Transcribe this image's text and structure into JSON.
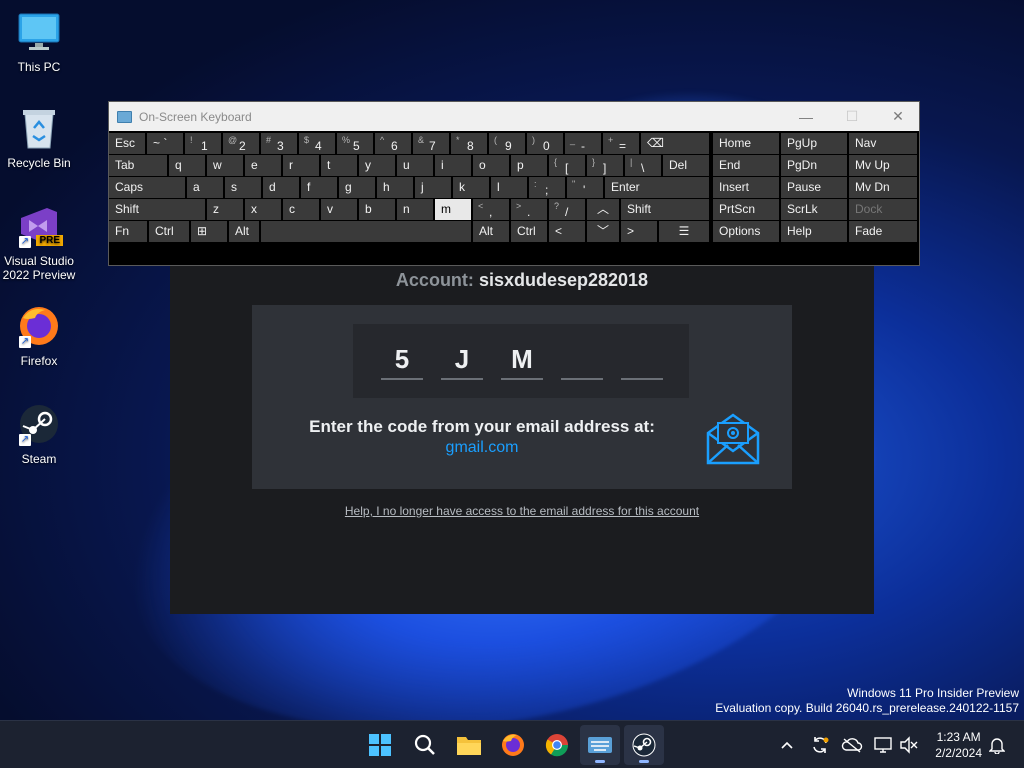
{
  "desktop": {
    "icons": [
      {
        "label": "This PC",
        "icon": "monitor-icon"
      },
      {
        "label": "Recycle Bin",
        "icon": "recycle-bin-icon"
      },
      {
        "label": "Visual Studio\n2022 Preview",
        "icon": "visual-studio-icon",
        "badge": "PRE"
      },
      {
        "label": "Firefox",
        "icon": "firefox-icon"
      },
      {
        "label": "Steam",
        "icon": "steam-icon"
      }
    ]
  },
  "steam": {
    "account_label": "Account:",
    "account_name": "sisxdudesep282018",
    "code_chars": [
      "5",
      "J",
      "M",
      "",
      ""
    ],
    "enter_text": "Enter the code from your email address at:",
    "email_domain": "gmail.com",
    "help_link": "Help, I no longer have access to the email address for this account",
    "accent_color": "#1a9fff"
  },
  "osk": {
    "title": "On-Screen Keyboard",
    "row1": [
      "Esc",
      "1",
      "2",
      "3",
      "4",
      "5",
      "6",
      "7",
      "8",
      "9",
      "0",
      "-",
      "="
    ],
    "row1_shift": [
      "",
      "~ `",
      "!",
      "@",
      "#",
      "$",
      "%",
      "^",
      "&",
      "*",
      "(",
      ")",
      "_",
      "+"
    ],
    "row2": [
      "Tab",
      "q",
      "w",
      "e",
      "r",
      "t",
      "y",
      "u",
      "i",
      "o",
      "p",
      "[",
      "]",
      "\\",
      "Del"
    ],
    "row2_shift": [
      "{",
      "}",
      "|"
    ],
    "row3": [
      "Caps",
      "a",
      "s",
      "d",
      "f",
      "g",
      "h",
      "j",
      "k",
      "l",
      ";",
      "'",
      "Enter"
    ],
    "row3_shift": [
      ":",
      "\""
    ],
    "row4": [
      "Shift",
      "z",
      "x",
      "c",
      "v",
      "b",
      "n",
      "m",
      ",",
      ".",
      "/",
      "Shift"
    ],
    "row4_shift": [
      "<",
      ">",
      "?"
    ],
    "row5": [
      "Fn",
      "Ctrl",
      "Alt",
      "Alt",
      "Ctrl"
    ],
    "nav": [
      [
        "Home",
        "PgUp",
        "Nav"
      ],
      [
        "End",
        "PgDn",
        "Mv Up"
      ],
      [
        "Insert",
        "Pause",
        "Mv Dn"
      ],
      [
        "PrtScn",
        "ScrLk",
        "Dock"
      ],
      [
        "Options",
        "Help",
        "Fade"
      ]
    ],
    "pressed_key": "m"
  },
  "watermark": {
    "line1": "Windows 11 Pro Insider Preview",
    "line2": "Evaluation copy. Build 26040.rs_prerelease.240122-1157"
  },
  "taskbar": {
    "apps": [
      "start-icon",
      "search-icon",
      "file-explorer-icon",
      "firefox-icon",
      "chrome-icon",
      "on-screen-keyboard-icon",
      "steam-icon"
    ],
    "time": "1:23 AM",
    "date": "2/2/2024"
  }
}
